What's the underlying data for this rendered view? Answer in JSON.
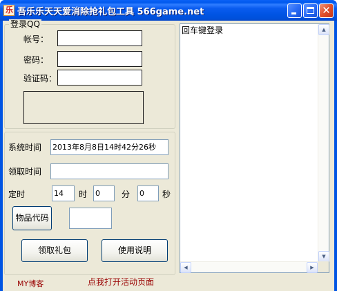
{
  "window": {
    "title": "吾乐乐天天爱消除抢礼包工具 566game.net",
    "app_icon_glyph": "乐",
    "minimize_icon": "minimize-icon",
    "maximize_icon": "maximize-icon",
    "close_icon": "close-icon",
    "close_glyph": "✕"
  },
  "login": {
    "group_title": "登录QQ",
    "account_label": "帐号：",
    "account_value": "",
    "password_label": "密码：",
    "password_value": "",
    "captcha_label": "验证码：",
    "captcha_value": ""
  },
  "timing": {
    "system_time_label": "系统时间",
    "system_time_value": "2013年8月8日14时42分26秒",
    "claim_time_label": "领取时间",
    "claim_time_value": "",
    "schedule_label": "定时",
    "hour_value": "14",
    "hour_unit": "时",
    "minute_value": "0",
    "minute_unit": "分",
    "second_value": "0",
    "second_unit": "秒",
    "item_code_button": "物品代码",
    "item_code_value": ""
  },
  "actions": {
    "claim_button": "领取礼包",
    "help_button": "使用说明"
  },
  "log": {
    "text": "回车键登录"
  },
  "footer": {
    "blog_link": "MY博客",
    "activity_link": "点我打开活动页面"
  },
  "colors": {
    "titlebar": "#0054e3",
    "client_bg": "#ece9d8",
    "footer_link": "#990000"
  }
}
